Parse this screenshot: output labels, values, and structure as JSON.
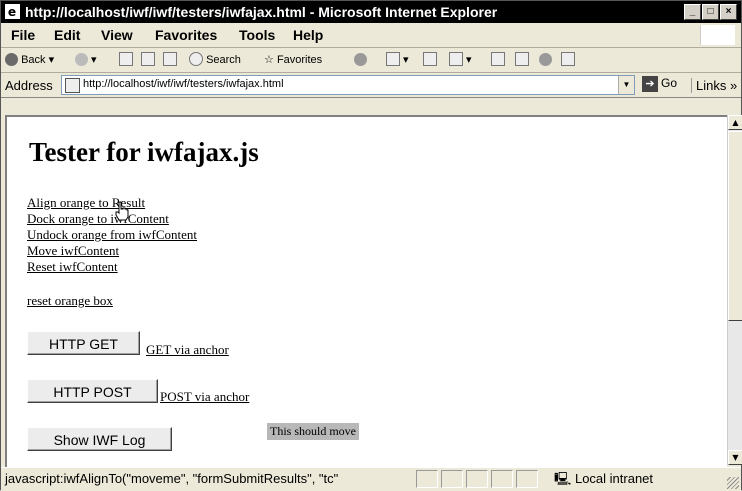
{
  "window": {
    "title": "http://localhost/iwf/iwf/testers/iwfajax.html - Microsoft Internet Explorer",
    "controls": {
      "minimize": "_",
      "maximize": "□",
      "close": "×"
    }
  },
  "menu": [
    "File",
    "Edit",
    "View",
    "Favorites",
    "Tools",
    "Help"
  ],
  "toolbar": {
    "back": "Back",
    "search": "Search",
    "favorites": "Favorites"
  },
  "address": {
    "label": "Address",
    "url": "http://localhost/iwf/iwf/testers/iwfajax.html",
    "go": "Go",
    "links": "Links »"
  },
  "page": {
    "heading": "Tester for iwfajax.js",
    "links": [
      "Align orange to Result",
      "Dock orange to iwfContent",
      "Undock orange from iwfContent",
      "Move iwfContent",
      "Reset iwfContent"
    ],
    "reset_link": "reset orange box",
    "http_get_button": "HTTP GET",
    "get_anchor": "GET via anchor",
    "http_post_button": "HTTP POST",
    "post_anchor": "POST via anchor",
    "show_log_button": "Show IWF Log",
    "move_box": "This should move"
  },
  "status": {
    "text": "javascript:iwfAlignTo(\"moveme\", \"formSubmitResults\", \"tc\"",
    "zone": "Local intranet"
  }
}
